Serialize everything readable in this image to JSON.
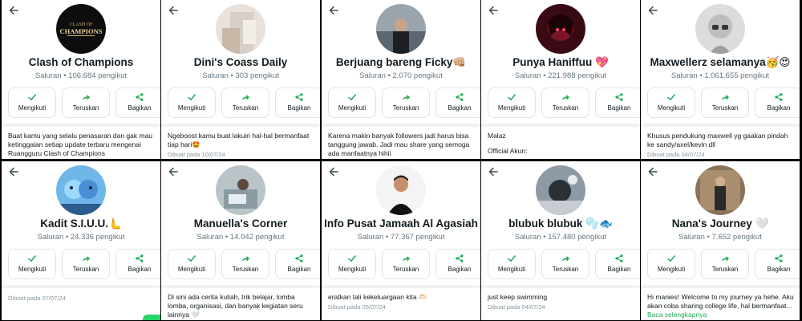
{
  "actions": {
    "follow": "Mengikuti",
    "forward": "Teruskan",
    "share": "Bagikan"
  },
  "channels": [
    {
      "title": "Clash of Champions",
      "subtitle": "Saluran • 106.684 pengikut",
      "desc": "Buat kamu yang selalu penasaran dan gak mau ketinggalan setiap update terbaru mengenai Ruangguru Clash of Champions",
      "meta": "",
      "more": ""
    },
    {
      "title": "Dini's Coass Daily",
      "subtitle": "Saluran • 303 pengikut",
      "desc": "Ngeboost kamu buat lakuin hal-hal bermanfaat tiap hari🤩",
      "meta": "Dibuat pada 10/07/24",
      "more": ""
    },
    {
      "title": "Berjuang bareng Ficky👊🏼",
      "subtitle": "Saluran • 2.070 pengikut",
      "desc": "Karena makin banyak followers jadi harus bisa tanggung jawab. Jadi mau share yang semoga ada manfaatnya hihii",
      "meta": "",
      "more": ""
    },
    {
      "title": "Punya Haniffuu 💖",
      "subtitle": "Saluran • 221.988 pengikut",
      "desc": "Malaz",
      "desc2": "Official Akun:",
      "meta": "",
      "more": ""
    },
    {
      "title": "Maxwellerz selamanya🥳😍",
      "subtitle": "Saluran • 1.061.655 pengikut",
      "desc": "Khusus pendukung maxwell yg gaakan pindah ke sandy/axel/kevin dll",
      "meta": "Dibuat pada 04/07/24",
      "more": ""
    },
    {
      "title": "Kadit S.I.U.U.🫷",
      "subtitle": "Saluran • 24.336 pengikut",
      "desc": "",
      "meta": "Dibuat pada 07/07/24",
      "more": ""
    },
    {
      "title": "Manuella's Corner",
      "subtitle": "Saluran • 14.042 pengikut",
      "desc": "Di sini ada cerita kuliah, trik belajar, lomba lomba, organisasi, dan banyak kegiatan seru lainnya 🤍",
      "meta": "",
      "more": ""
    },
    {
      "title": "Info Pusat Jamaah Al Agasiah",
      "subtitle": "Saluran • 77.367 pengikut",
      "desc": "eratkan tali kekeluargaan kita 🫶🏻",
      "meta": "Dibuat pada 05/07/24",
      "more": ""
    },
    {
      "title": "blubuk blubuk 🫧🐟",
      "subtitle": "Saluran • 157.480 pengikut",
      "desc": "just keep swimming",
      "meta": "Dibuat pada 04/07/24",
      "more": ""
    },
    {
      "title": "Nana's Journey 🤍",
      "subtitle": "Saluran • 7.652 pengikut",
      "desc": "Hi manies! Welcome to my journey ya hehe. Aku akan coba sharing college life, hal bermanfaat...",
      "meta": "",
      "more": "Baca selengkapnya"
    }
  ],
  "avatar_text": {
    "top": "CLASH OF",
    "main": "CHAMPIONS"
  },
  "colors": {
    "accent": "#1fa855",
    "border": "#e0e3e5",
    "muted": "#667781"
  }
}
